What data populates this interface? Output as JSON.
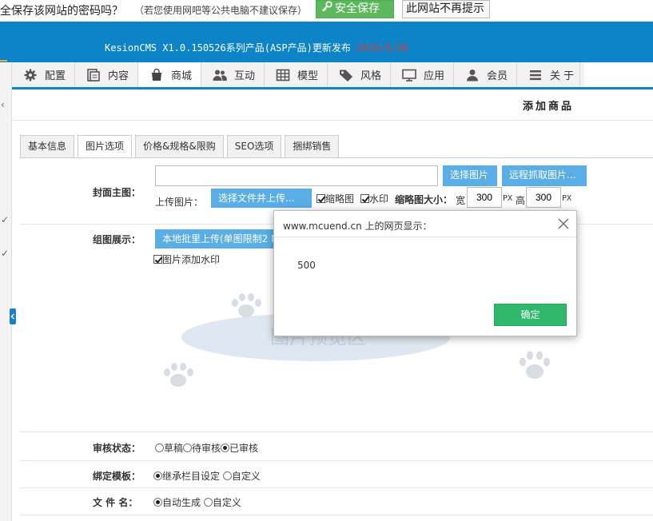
{
  "password_bar": {
    "question": "全保存该网站的密码吗？",
    "hint": "（若您使用网吧等公共电脑不建议保存）",
    "save_label": "安全保存",
    "never_label": "此网站不再提示"
  },
  "header": {
    "news_text": "KesionCMS X1.0.150526系列产品(ASP产品)更新发布 ",
    "news_date": "2015/5/26"
  },
  "nav": [
    {
      "label": "配置",
      "icon": "gear-icon"
    },
    {
      "label": "内容",
      "icon": "document-icon"
    },
    {
      "label": "商城",
      "icon": "shopping-bag-icon"
    },
    {
      "label": "互动",
      "icon": "users-icon"
    },
    {
      "label": "模型",
      "icon": "grid-icon"
    },
    {
      "label": "风格",
      "icon": "tag-icon"
    },
    {
      "label": "应用",
      "icon": "monitor-icon"
    },
    {
      "label": "会员",
      "icon": "user-icon"
    },
    {
      "label": "关 于",
      "icon": "menu-icon"
    }
  ],
  "page_title": "添加商品",
  "subtabs": [
    "基本信息",
    "图片选项",
    "价格&规格&限购",
    "SEO选项",
    "捆绑销售"
  ],
  "form": {
    "cover_label": "封面主图：",
    "cover_value": "",
    "select_image": "选择图片",
    "remote_fetch": "远程抓取图片...",
    "upload_label": "上传图片：",
    "upload_button": "选择文件并上传...",
    "thumb_label": "缩略图",
    "watermark_label": "水印",
    "thumb_size_label": "缩略图大小：",
    "width_label": "宽",
    "width_value": "300",
    "px1": "PX",
    "height_label": "高",
    "height_value": "300",
    "px2": "PX",
    "gallery_label": "组图展示：",
    "batch_upload": "本地批里上传(单图限制2 MB)",
    "gallery_watermark": "图片添加水印",
    "watermark_image_text": "图片预览区",
    "review_label": "审核状态：",
    "review_options": [
      "草稿",
      "待审核",
      "已审核"
    ],
    "template_label": "绑定模板：",
    "template_options": [
      "继承栏目设定",
      "自定义"
    ],
    "filename_label": "文 件 名：",
    "filename_options": [
      "自动生成",
      "自定义"
    ]
  },
  "dialog": {
    "title": "www.mcuend.cn 上的网页显示：",
    "message": "500",
    "ok_label": "确定"
  },
  "colors": {
    "header_blue": "#0c84c7",
    "save_green": "#5cb85c",
    "button_blue": "#5aaee6",
    "ok_green": "#2fb86c",
    "date_red": "#e03b3b"
  }
}
